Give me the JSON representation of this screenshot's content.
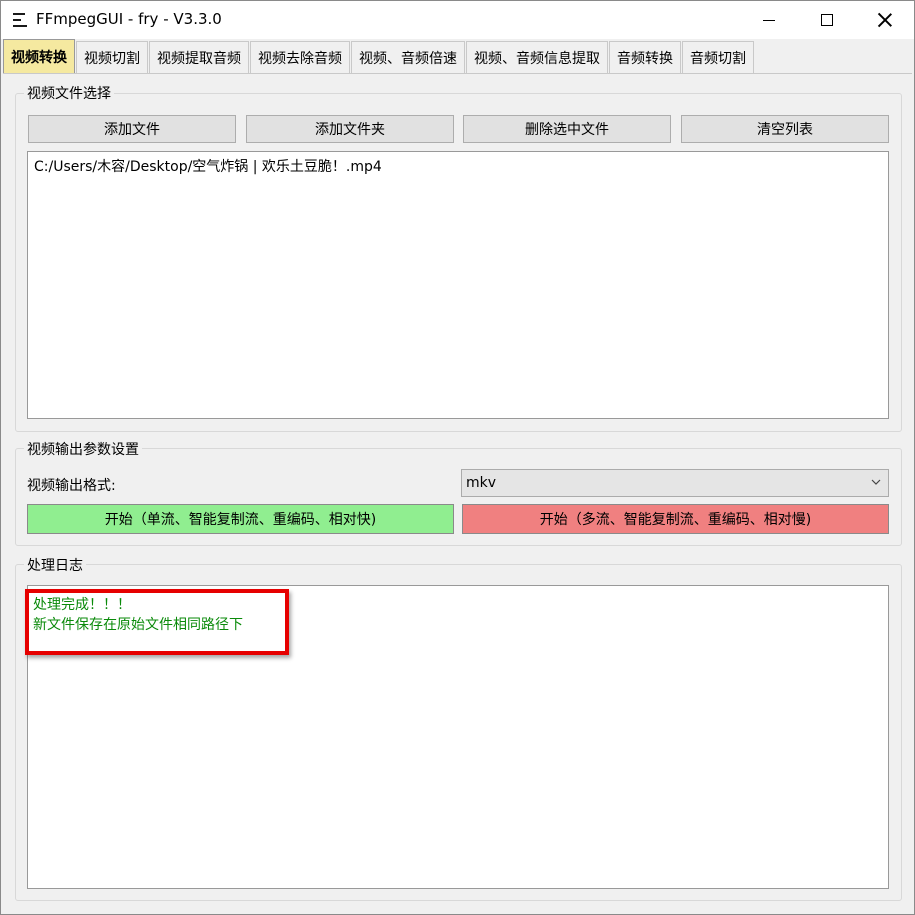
{
  "window": {
    "title": "FFmpegGUI - fry - V3.3.0"
  },
  "tabs": [
    {
      "label": "视频转换",
      "active": true
    },
    {
      "label": "视频切割",
      "active": false
    },
    {
      "label": "视频提取音频",
      "active": false
    },
    {
      "label": "视频去除音频",
      "active": false
    },
    {
      "label": "视频、音频倍速",
      "active": false
    },
    {
      "label": "视频、音频信息提取",
      "active": false
    },
    {
      "label": "音频转换",
      "active": false
    },
    {
      "label": "音频切割",
      "active": false
    }
  ],
  "file_select": {
    "title": "视频文件选择",
    "add_file": "添加文件",
    "add_folder": "添加文件夹",
    "delete_selected": "删除选中文件",
    "clear_list": "清空列表",
    "files": [
      "C:/Users/木容/Desktop/空气炸锅 | 欢乐土豆脆！.mp4"
    ]
  },
  "output_settings": {
    "title": "视频输出参数设置",
    "format_label": "视频输出格式:",
    "format_value": "mkv",
    "start_fast": "开始（单流、智能复制流、重编码、相对快)",
    "start_slow": "开始（多流、智能复制流、重编码、相对慢)"
  },
  "log": {
    "title": "处理日志",
    "lines": [
      "处理完成！！！",
      "新文件保存在原始文件相同路径下"
    ],
    "text_color": "#0a8a0a"
  },
  "colors": {
    "active_tab": "#f5e9a0",
    "start_fast_bg": "#90ee90",
    "start_slow_bg": "#f08080",
    "highlight": "#e60000"
  }
}
